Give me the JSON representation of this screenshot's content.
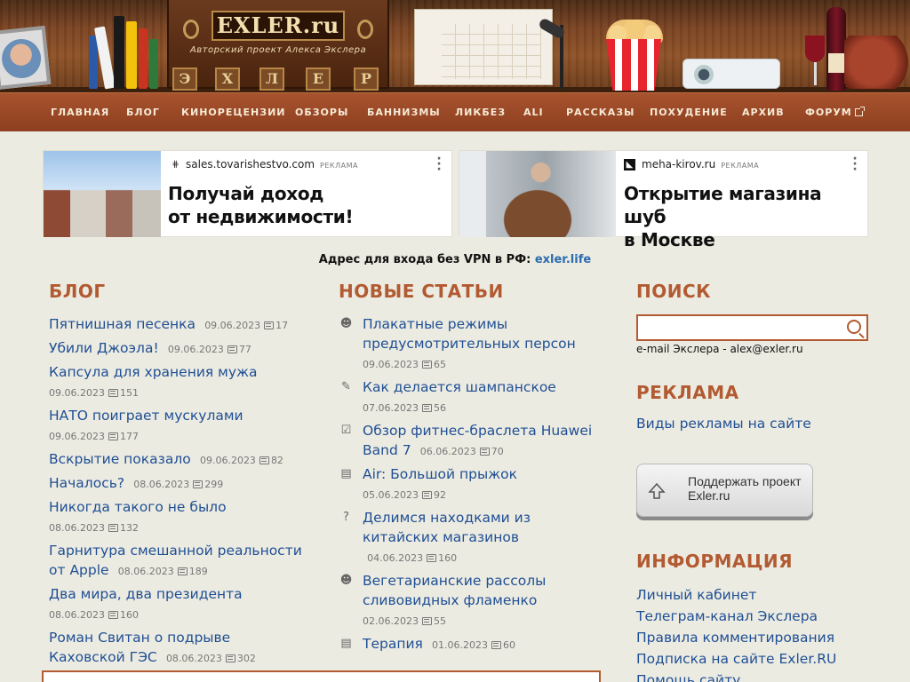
{
  "site": {
    "logo": "EXLER.ru",
    "tagline": "Авторский проект Алекса Экслера",
    "shelf_letters": [
      "Э",
      "Х",
      "Л",
      "Е",
      "Р"
    ]
  },
  "nav": [
    {
      "label": "ГЛАВНАЯ"
    },
    {
      "label": "БЛОГ"
    },
    {
      "label": "КИНОРЕЦЕНЗИИ"
    },
    {
      "label": "ОБЗОРЫ"
    },
    {
      "label": "БАННИЗМЫ"
    },
    {
      "label": "ЛИКБЕЗ"
    },
    {
      "label": "ALI"
    },
    {
      "label": "РАССКАЗЫ"
    },
    {
      "label": "ПОХУДЕНИЕ"
    },
    {
      "label": "АРХИВ"
    },
    {
      "label": "ФОРУМ"
    }
  ],
  "ads": [
    {
      "domain": "sales.tovarishestvo.com",
      "tag": "РЕКЛАМА",
      "headline_1": "Получай доход",
      "headline_2": "от недвижимости!"
    },
    {
      "domain": "meha-kirov.ru",
      "tag": "РЕКЛАМА",
      "headline_1": "Открытие магазина шуб",
      "headline_2": "в Москве"
    }
  ],
  "vpn": {
    "text": "Адрес для входа без VPN в РФ:",
    "link": "exler.life"
  },
  "blog": {
    "title": "БЛОГ",
    "items": [
      {
        "title": "Пятнишная песенка",
        "date": "09.06.2023",
        "comments": "17"
      },
      {
        "title": "Убили Джоэла!",
        "date": "09.06.2023",
        "comments": "77"
      },
      {
        "title": "Капсула для хранения мужа",
        "date": "09.06.2023",
        "comments": "151"
      },
      {
        "title": "НАТО поиграет мускулами",
        "date": "09.06.2023",
        "comments": "177"
      },
      {
        "title": "Вскрытие показало",
        "date": "09.06.2023",
        "comments": "82"
      },
      {
        "title": "Началось?",
        "date": "08.06.2023",
        "comments": "299"
      },
      {
        "title": "Никогда такого не было",
        "date": "08.06.2023",
        "comments": "132"
      },
      {
        "title": "Гарнитура смешанной реальности от Apple",
        "date": "08.06.2023",
        "comments": "189"
      },
      {
        "title": "Два мира, два президента",
        "date": "08.06.2023",
        "comments": "160"
      },
      {
        "title": "Роман Свитан о подрыве Каховской ГЭС",
        "date": "08.06.2023",
        "comments": "302"
      }
    ]
  },
  "articles": {
    "title": "НОВЫЕ СТАТЬИ",
    "items": [
      {
        "icon": "smiley-icon",
        "glyph": "☻",
        "title": "Плакатные режимы предусмотрительных персон",
        "date": "09.06.2023",
        "comments": "65"
      },
      {
        "icon": "pencil-icon",
        "glyph": "✎",
        "title": "Как делается шампанское",
        "date": "07.06.2023",
        "comments": "56"
      },
      {
        "icon": "clipboard-check-icon",
        "glyph": "☑",
        "title": "Обзор фитнес-браслета Huawei Band 7",
        "date": "06.06.2023",
        "comments": "70"
      },
      {
        "icon": "clapperboard-icon",
        "glyph": "▤",
        "title": "Air: Большой прыжок",
        "date": "05.06.2023",
        "comments": "92"
      },
      {
        "icon": "question-bubble-icon",
        "glyph": "?",
        "title": "Делимся находками из китайских магазинов",
        "date": "04.06.2023",
        "comments": "160"
      },
      {
        "icon": "smiley-icon",
        "glyph": "☻",
        "title": "Вегетарианские рассолы сливовидных фламенко",
        "date": "02.06.2023",
        "comments": "55"
      },
      {
        "icon": "clapperboard-icon",
        "glyph": "▤",
        "title": "Терапия",
        "date": "01.06.2023",
        "comments": "60"
      }
    ]
  },
  "sidebar": {
    "search_title": "ПОИСК",
    "search_value": "",
    "email_text": "e-mail Экслера - alex@exler.ru",
    "ads_title": "РЕКЛАМА",
    "ads_link": "Виды рекламы на сайте",
    "support_line1": "Поддержать проект",
    "support_line2": "Exler.ru",
    "info_title": "ИНФОРМАЦИЯ",
    "info_links": [
      {
        "label": "Личный кабинет"
      },
      {
        "label": "Телеграм-канал Экслера"
      },
      {
        "label": "Правила комментирования"
      },
      {
        "label": "Подписка на сайте Exler.RU"
      },
      {
        "label": "Помощь сайту"
      }
    ]
  },
  "colors": {
    "accent": "#b25a31",
    "link": "#1f4f95",
    "nav_bg": "#9b4826",
    "page_bg": "#ecebe1"
  }
}
